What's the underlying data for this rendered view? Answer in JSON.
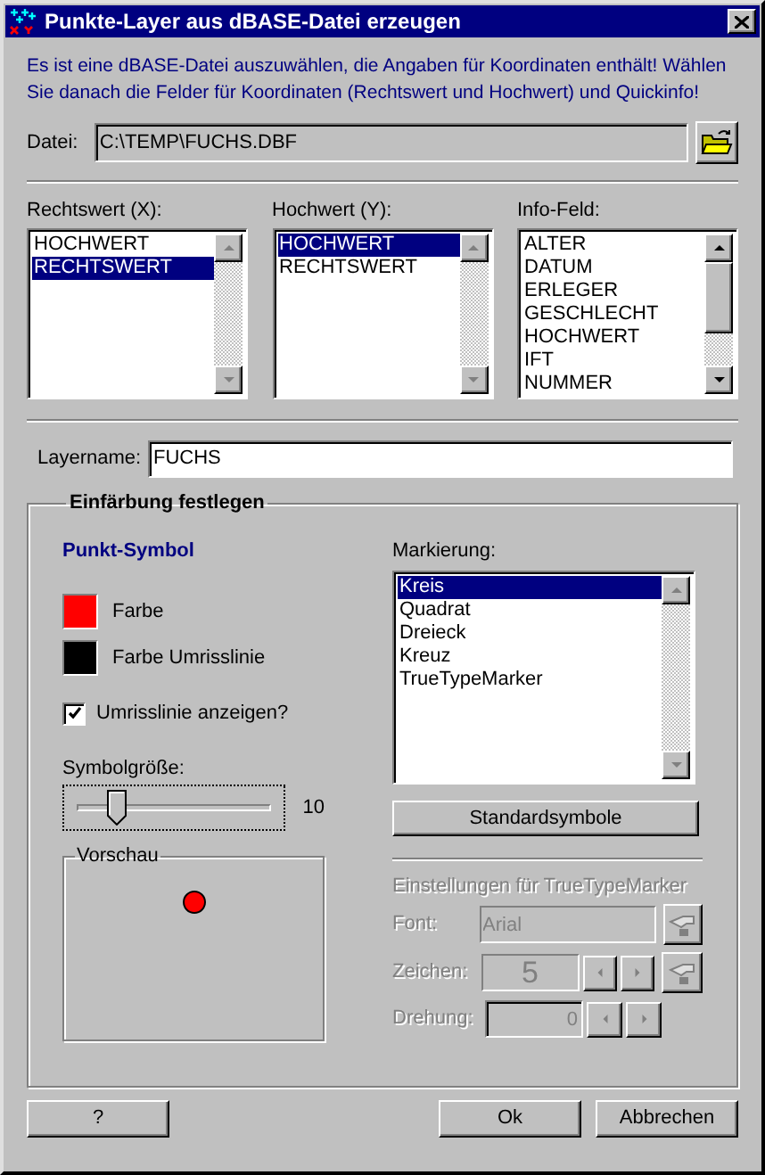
{
  "window": {
    "title": "Punkte-Layer aus dBASE-Datei erzeugen"
  },
  "intro": "Es ist eine dBASE-Datei auszuwählen, die Angaben für Koordinaten enthält! Wählen Sie danach die Felder für Koordinaten (Rechtswert und Hochwert) und Quickinfo!",
  "file": {
    "label": "Datei:",
    "value": "C:\\TEMP\\FUCHS.DBF"
  },
  "lists": [
    {
      "label": "Rechtswert (X):",
      "scrollable": false,
      "items": [
        {
          "text": "HOCHWERT",
          "selected": false
        },
        {
          "text": "RECHTSWERT",
          "selected": true
        }
      ]
    },
    {
      "label": "Hochwert (Y):",
      "scrollable": false,
      "items": [
        {
          "text": "HOCHWERT",
          "selected": true
        },
        {
          "text": "RECHTSWERT",
          "selected": false
        }
      ]
    },
    {
      "label": "Info-Feld:",
      "scrollable": true,
      "items": [
        {
          "text": "ALTER",
          "selected": false
        },
        {
          "text": "DATUM",
          "selected": false
        },
        {
          "text": "ERLEGER",
          "selected": false
        },
        {
          "text": "GESCHLECHT",
          "selected": false
        },
        {
          "text": "HOCHWERT",
          "selected": false
        },
        {
          "text": "IFT",
          "selected": false
        },
        {
          "text": "NUMMER",
          "selected": false
        }
      ]
    }
  ],
  "layer": {
    "label": "Layername:",
    "value": "FUCHS"
  },
  "coloring": {
    "title": "Einfärbung festlegen",
    "symbol_heading": "Punkt-Symbol",
    "swatches": [
      {
        "label": "Farbe",
        "color": "#ff0000"
      },
      {
        "label": "Farbe Umrisslinie",
        "color": "#000000"
      }
    ],
    "show_outline": {
      "label": "Umrisslinie anzeigen?",
      "checked": true
    },
    "size": {
      "label": "Symbolgröße:",
      "level": 0.2,
      "reading": "10"
    },
    "preview": {
      "title": "Vorschau"
    },
    "marker": {
      "label": "Markierung:",
      "scrollable": false,
      "items": [
        {
          "text": "Kreis",
          "selected": true
        },
        {
          "text": "Quadrat",
          "selected": false
        },
        {
          "text": "Dreieck",
          "selected": false
        },
        {
          "text": "Kreuz",
          "selected": false
        },
        {
          "text": "TrueTypeMarker",
          "selected": false
        }
      ]
    },
    "standard_button": "Standardsymbole",
    "truetype": {
      "title": "Einstellungen für TrueTypeMarker",
      "disabled": true,
      "font": {
        "label": "Font:",
        "value": "Arial"
      },
      "char": {
        "label": "Zeichen:",
        "value": "5"
      },
      "rotation": {
        "label": "Drehung:",
        "value": "0"
      }
    }
  },
  "buttons": {
    "help": "?",
    "ok": "Ok",
    "cancel": "Abbrechen"
  }
}
